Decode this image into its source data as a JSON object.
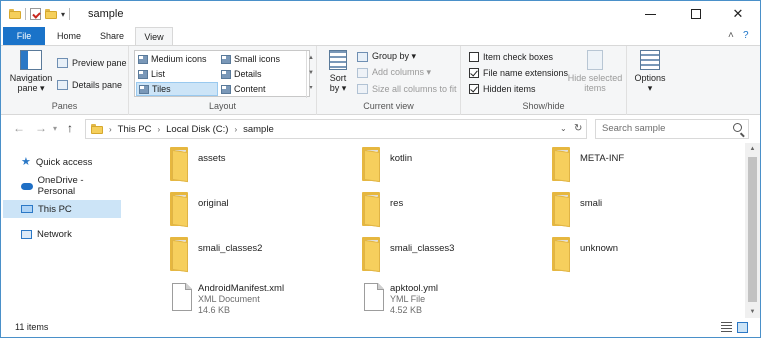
{
  "window": {
    "title": "sample",
    "minimize_label": "—",
    "close_label": "✕"
  },
  "tabs": {
    "file": "File",
    "home": "Home",
    "share": "Share",
    "view": "View"
  },
  "ribbon": {
    "panes": {
      "navigation_pane": "Navigation",
      "navigation_pane_2": "pane ▾",
      "preview_pane": "Preview pane",
      "details_pane": "Details pane",
      "label": "Panes"
    },
    "layout": {
      "medium_icons": "Medium icons",
      "small_icons": "Small icons",
      "list": "List",
      "details": "Details",
      "tiles": "Tiles",
      "content": "Content",
      "selected": "Tiles",
      "label": "Layout"
    },
    "current_view": {
      "sort_by": "Sort",
      "sort_by_2": "by ▾",
      "group_by": "Group by ▾",
      "add_columns": "Add columns ▾",
      "size_all_columns": "Size all columns to fit",
      "label": "Current view"
    },
    "show_hide": {
      "item_check_boxes": "Item check boxes",
      "item_check_boxes_checked": false,
      "file_name_extensions": "File name extensions",
      "file_name_extensions_checked": true,
      "hidden_items": "Hidden items",
      "hidden_items_checked": true,
      "hide_selected_items": "Hide selected",
      "hide_selected_items_2": "items",
      "label": "Show/hide"
    },
    "options": {
      "label": "Options",
      "label_2": "▾"
    }
  },
  "address": {
    "crumbs": [
      "This PC",
      "Local Disk (C:)",
      "sample"
    ],
    "search_placeholder": "Search sample"
  },
  "nav_pane": {
    "items": [
      {
        "label": "Quick access",
        "icon": "star-icon"
      },
      {
        "label": "OneDrive - Personal",
        "icon": "cloud-icon"
      },
      {
        "label": "This PC",
        "icon": "pc-icon",
        "selected": true
      },
      {
        "label": "Network",
        "icon": "network-icon"
      }
    ]
  },
  "items": [
    {
      "name": "assets",
      "type": "folder"
    },
    {
      "name": "kotlin",
      "type": "folder"
    },
    {
      "name": "META-INF",
      "type": "folder"
    },
    {
      "name": "original",
      "type": "folder"
    },
    {
      "name": "res",
      "type": "folder"
    },
    {
      "name": "smali",
      "type": "folder"
    },
    {
      "name": "smali_classes2",
      "type": "folder"
    },
    {
      "name": "smali_classes3",
      "type": "folder"
    },
    {
      "name": "unknown",
      "type": "folder"
    },
    {
      "name": "AndroidManifest.xml",
      "type": "file",
      "kind": "XML Document",
      "size": "14.6 KB"
    },
    {
      "name": "apktool.yml",
      "type": "file",
      "kind": "YML File",
      "size": "4.52 KB"
    }
  ],
  "status": {
    "item_count": "11 items"
  }
}
